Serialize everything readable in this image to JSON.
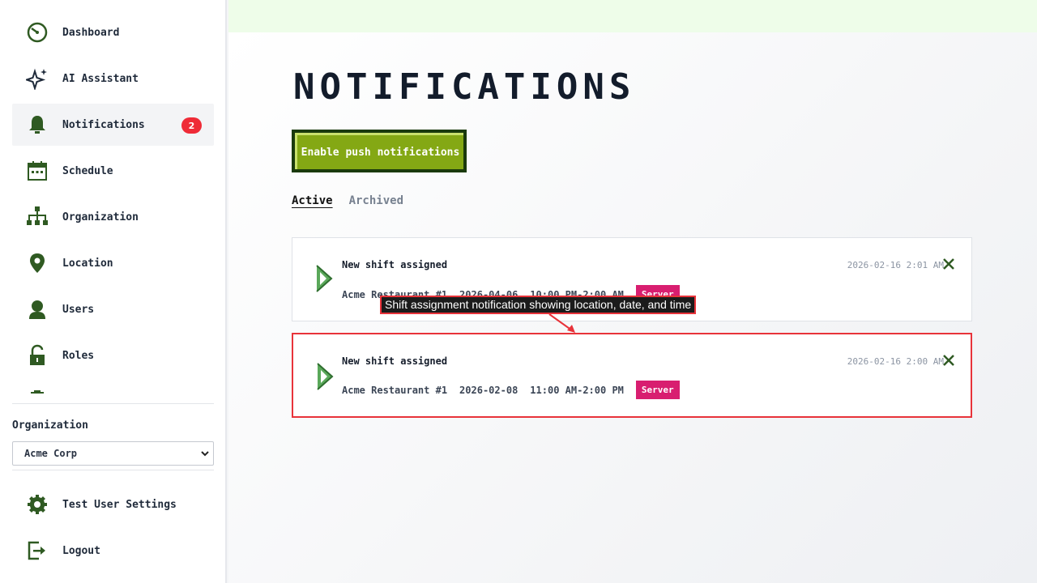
{
  "sidebar": {
    "items": [
      {
        "label": "Dashboard",
        "icon": "dashboard-icon"
      },
      {
        "label": "AI Assistant",
        "icon": "sparkle-icon"
      },
      {
        "label": "Notifications",
        "icon": "bell-icon",
        "badge": "2",
        "active": true
      },
      {
        "label": "Schedule",
        "icon": "calendar-icon"
      },
      {
        "label": "Organization",
        "icon": "org-chart-icon"
      },
      {
        "label": "Location",
        "icon": "location-pin-icon"
      },
      {
        "label": "Users",
        "icon": "user-icon"
      },
      {
        "label": "Roles",
        "icon": "lock-icon"
      }
    ],
    "organization_label": "Organization",
    "organization_select": "Acme Corp",
    "settings_label": "Test User Settings",
    "logout_label": "Logout"
  },
  "main": {
    "title": "NOTIFICATIONS",
    "push_button": "Enable push notifications",
    "tabs": [
      "Active",
      "Archived"
    ],
    "notifications": [
      {
        "title": "New shift assigned",
        "location": "Acme Restaurant #1",
        "date": "2026-04-06",
        "time": "10:00 PM-2:00 AM",
        "role": "Server",
        "timestamp": "2026-02-16 2:01 AM"
      },
      {
        "title": "New shift assigned",
        "location": "Acme Restaurant #1",
        "date": "2026-02-08",
        "time": "11:00 AM-2:00 PM",
        "role": "Server",
        "timestamp": "2026-02-16 2:00 AM"
      }
    ]
  },
  "annotation": "Shift assignment notification showing location, date, and time",
  "colors": {
    "accent_green": "#84a814",
    "dark_green": "#1a3a0c",
    "badge_red": "#ef2b37",
    "role_pink": "#d81e70",
    "highlight_red": "#e8333a"
  }
}
